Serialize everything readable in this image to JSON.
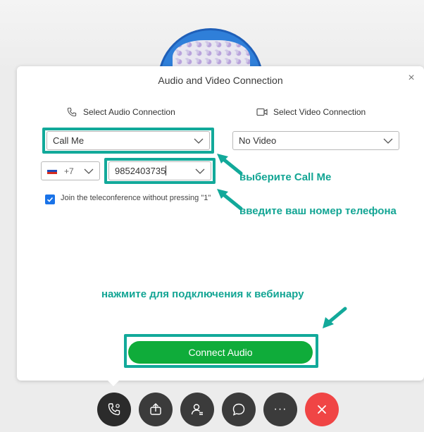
{
  "dialog": {
    "title": "Audio and Video Connection",
    "close_label": "×"
  },
  "audio": {
    "section_label": "Select Audio Connection",
    "selected": "Call Me",
    "country_code": "+7",
    "phone_number": "9852403735"
  },
  "video": {
    "section_label": "Select Video Connection",
    "selected": "No Video"
  },
  "option": {
    "checked": true,
    "label": "Join the teleconference without pressing \"1\""
  },
  "connect_button": {
    "label": "Connect Audio"
  },
  "annotations": {
    "select_call_me": "выберите Call Me",
    "enter_phone": "введите ваш номер телефона",
    "press_connect": "нажмите для подключения к вебинару"
  },
  "colors": {
    "highlight": "#12a99a",
    "connect": "#0fac3a",
    "end_call": "#f04545",
    "checkbox": "#1a73e8"
  },
  "toolbar": {
    "buttons": [
      "phone-settings-icon",
      "share-icon",
      "participants-icon",
      "chat-icon",
      "more-icon",
      "end-call-icon"
    ],
    "more_label": "···"
  }
}
